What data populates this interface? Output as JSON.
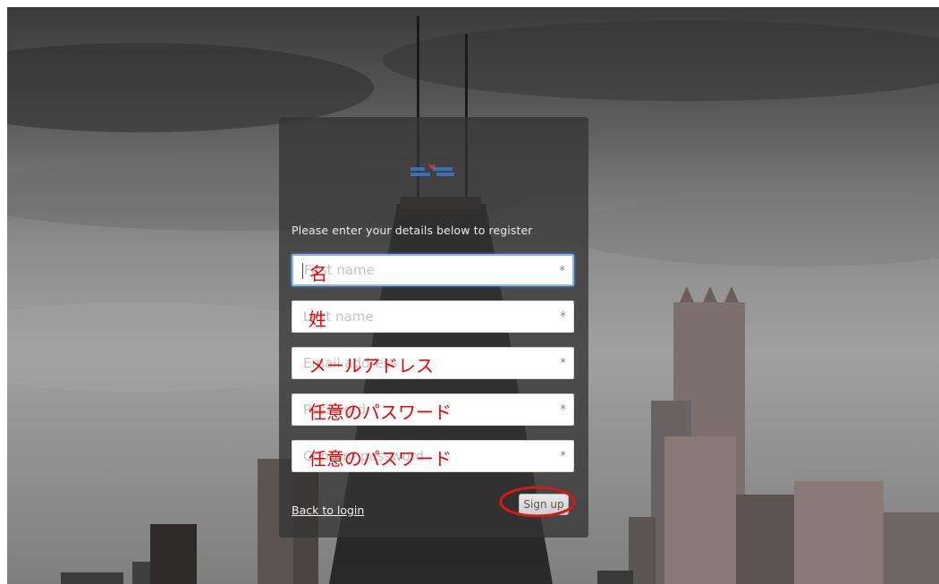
{
  "form": {
    "intro_text": "Please enter your details below to register",
    "fields": [
      {
        "placeholder": "First name",
        "required_mark": "*",
        "annotation": "名"
      },
      {
        "placeholder": "Last name",
        "required_mark": "*",
        "annotation": "姓"
      },
      {
        "placeholder": "Email address",
        "required_mark": "*",
        "annotation": "メールアドレス"
      },
      {
        "placeholder": "Password",
        "required_mark": "*",
        "annotation": "任意のパスワード"
      },
      {
        "placeholder": "Confirm password",
        "required_mark": "*",
        "annotation": "任意のパスワード"
      }
    ],
    "back_link": "Back to login",
    "signup_label": "Sign up"
  },
  "colors": {
    "annotation": "#ee0000",
    "panel": "#343434",
    "focus_border": "#86b7e8"
  },
  "icons": {
    "logo": "brand-logo",
    "required": "asterisk-icon"
  }
}
